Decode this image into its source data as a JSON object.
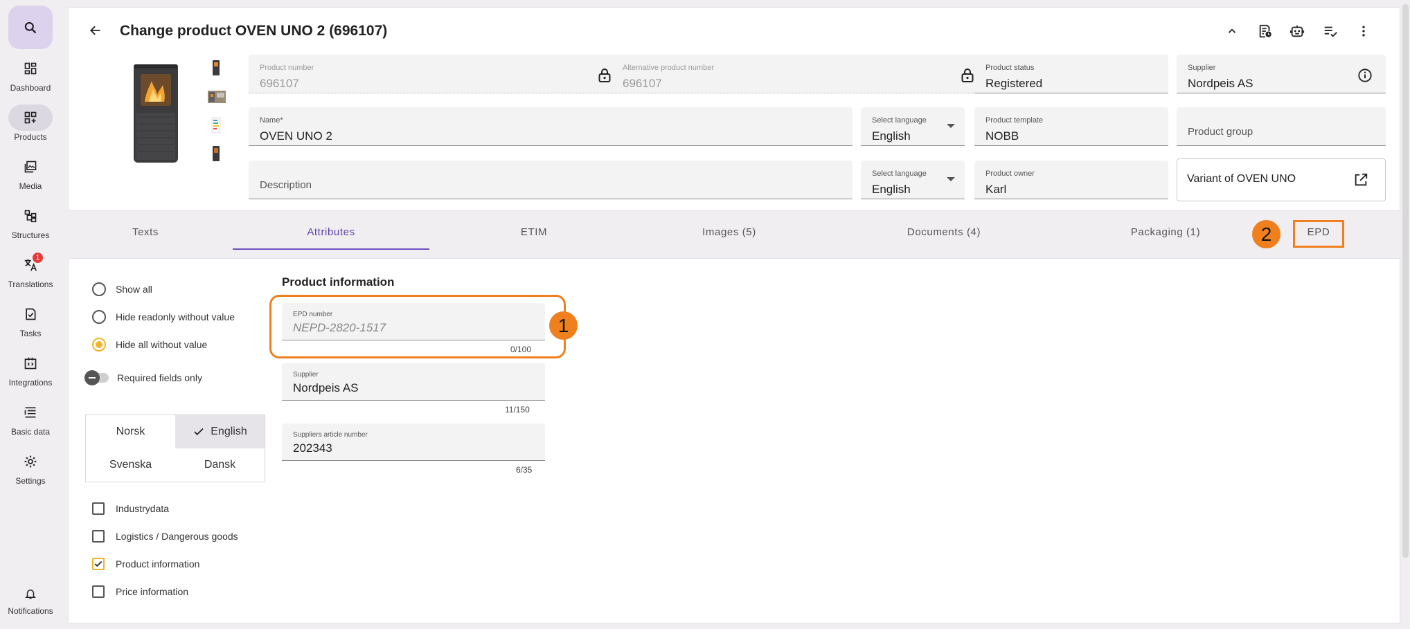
{
  "sidebar": {
    "items": [
      {
        "label": "Dashboard",
        "icon": "dashboard-icon"
      },
      {
        "label": "Products",
        "icon": "products-icon"
      },
      {
        "label": "Media",
        "icon": "media-icon"
      },
      {
        "label": "Structures",
        "icon": "structures-icon"
      },
      {
        "label": "Translations",
        "icon": "translate-icon",
        "badge": "1"
      },
      {
        "label": "Tasks",
        "icon": "tasks-icon"
      },
      {
        "label": "Integrations",
        "icon": "integrations-icon"
      },
      {
        "label": "Basic data",
        "icon": "basic-data-icon"
      },
      {
        "label": "Settings",
        "icon": "gear-icon"
      },
      {
        "label": "Notifications",
        "icon": "bell-icon"
      }
    ]
  },
  "header": {
    "title": "Change product OVEN UNO 2 (696107)"
  },
  "fields": {
    "product_number": {
      "label": "Product number",
      "value": "696107"
    },
    "alt_product_number": {
      "label": "Alternative product number",
      "value": "696107"
    },
    "product_status": {
      "label": "Product status",
      "value": "Registered"
    },
    "supplier": {
      "label": "Supplier",
      "value": "Nordpeis AS"
    },
    "name": {
      "label": "Name*",
      "value": "OVEN UNO 2"
    },
    "name_language": {
      "label": "Select language",
      "value": "English"
    },
    "product_template": {
      "label": "Product template",
      "value": "NOBB"
    },
    "product_group": {
      "placeholder": "Product group"
    },
    "description": {
      "placeholder": "Description"
    },
    "desc_language": {
      "label": "Select language",
      "value": "English"
    },
    "product_owner": {
      "label": "Product owner",
      "value": "Karl"
    },
    "variant": {
      "text": "Variant of OVEN UNO"
    }
  },
  "tabs": [
    {
      "label": "Texts"
    },
    {
      "label": "Attributes"
    },
    {
      "label": "ETIM"
    },
    {
      "label": "Images (5)"
    },
    {
      "label": "Documents (4)"
    },
    {
      "label": "Packaging (1)"
    },
    {
      "label": "EPD"
    }
  ],
  "callouts": {
    "one": "1",
    "two": "2"
  },
  "filters": {
    "show_all": "Show all",
    "hide_readonly": "Hide readonly without value",
    "hide_all": "Hide all without value",
    "required_only": "Required fields only"
  },
  "languages": {
    "norsk": "Norsk",
    "english": "English",
    "svenska": "Svenska",
    "dansk": "Dansk"
  },
  "groups": {
    "industry": "Industrydata",
    "logistics": "Logistics / Dangerous goods",
    "product_info": "Product information",
    "price_info": "Price information"
  },
  "attributes": {
    "section_title": "Product information",
    "epd_number": {
      "label": "EPD number",
      "placeholder": "NEPD-2820-1517",
      "counter": "0/100"
    },
    "supplier": {
      "label": "Supplier",
      "value": "Nordpeis AS",
      "counter": "11/150"
    },
    "article_number": {
      "label": "Suppliers article number",
      "value": "202343",
      "counter": "6/35"
    }
  },
  "colors": {
    "accent": "#6d4fc0",
    "highlight": "#f07f1d",
    "check": "#f0b429"
  }
}
